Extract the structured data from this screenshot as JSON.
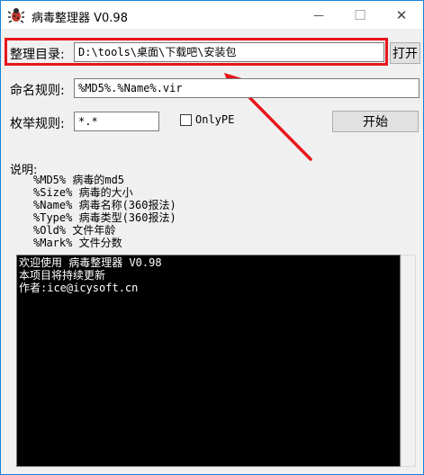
{
  "window": {
    "title": "病毒整理器 V0.98",
    "minimize_glyph": "—",
    "maximize_glyph": "☐",
    "close_glyph": "✕"
  },
  "form": {
    "dir_label": "整理目录:",
    "dir_value": "D:\\tools\\桌面\\下载吧\\安装包",
    "open_button": "打开",
    "naming_label": "命名规则:",
    "naming_value": "%MD5%.%Name%.vir",
    "enum_label": "枚举规则:",
    "enum_value": "*.*",
    "onlype_label": "OnlyPE",
    "onlype_checked": false,
    "start_button": "开始"
  },
  "description": {
    "heading": "说明:",
    "lines": [
      "%MD5%  病毒的md5",
      "%Size% 病毒的大小",
      "%Name% 病毒名称(360报法)",
      "%Type% 病毒类型(360报法)",
      "%Old%  文件年龄",
      "%Mark% 文件分数"
    ]
  },
  "console": {
    "lines": [
      "欢迎使用 病毒整理器 V0.98",
      "本项目将持续更新",
      "作者:ice@icysoft.cn"
    ]
  },
  "colors": {
    "accent_border": "#1883d7",
    "highlight": "#e8161b",
    "console_bg": "#000000",
    "console_fg": "#ffffff"
  },
  "icons": {
    "app": "virus-bug-icon",
    "annotation": "red-arrow-icon"
  }
}
